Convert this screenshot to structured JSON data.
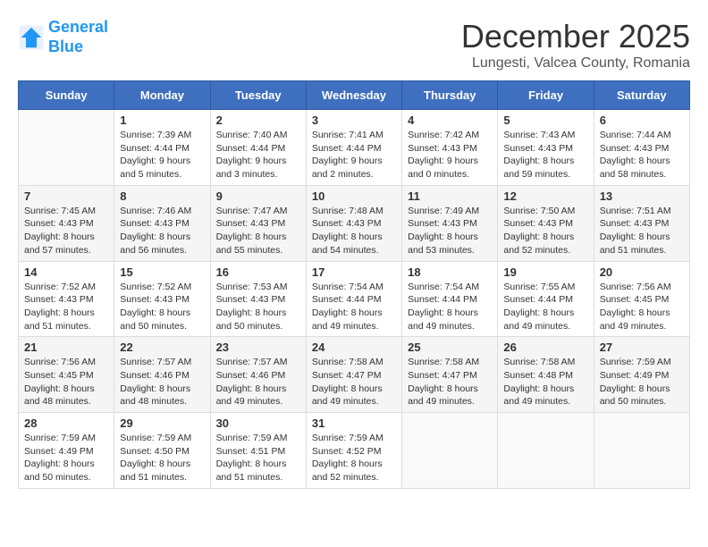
{
  "logo": {
    "line1": "General",
    "line2": "Blue"
  },
  "title": "December 2025",
  "subtitle": "Lungesti, Valcea County, Romania",
  "days_header": [
    "Sunday",
    "Monday",
    "Tuesday",
    "Wednesday",
    "Thursday",
    "Friday",
    "Saturday"
  ],
  "weeks": [
    [
      {
        "day": "",
        "sunrise": "",
        "sunset": "",
        "daylight": ""
      },
      {
        "day": "1",
        "sunrise": "Sunrise: 7:39 AM",
        "sunset": "Sunset: 4:44 PM",
        "daylight": "Daylight: 9 hours and 5 minutes."
      },
      {
        "day": "2",
        "sunrise": "Sunrise: 7:40 AM",
        "sunset": "Sunset: 4:44 PM",
        "daylight": "Daylight: 9 hours and 3 minutes."
      },
      {
        "day": "3",
        "sunrise": "Sunrise: 7:41 AM",
        "sunset": "Sunset: 4:44 PM",
        "daylight": "Daylight: 9 hours and 2 minutes."
      },
      {
        "day": "4",
        "sunrise": "Sunrise: 7:42 AM",
        "sunset": "Sunset: 4:43 PM",
        "daylight": "Daylight: 9 hours and 0 minutes."
      },
      {
        "day": "5",
        "sunrise": "Sunrise: 7:43 AM",
        "sunset": "Sunset: 4:43 PM",
        "daylight": "Daylight: 8 hours and 59 minutes."
      },
      {
        "day": "6",
        "sunrise": "Sunrise: 7:44 AM",
        "sunset": "Sunset: 4:43 PM",
        "daylight": "Daylight: 8 hours and 58 minutes."
      }
    ],
    [
      {
        "day": "7",
        "sunrise": "Sunrise: 7:45 AM",
        "sunset": "Sunset: 4:43 PM",
        "daylight": "Daylight: 8 hours and 57 minutes."
      },
      {
        "day": "8",
        "sunrise": "Sunrise: 7:46 AM",
        "sunset": "Sunset: 4:43 PM",
        "daylight": "Daylight: 8 hours and 56 minutes."
      },
      {
        "day": "9",
        "sunrise": "Sunrise: 7:47 AM",
        "sunset": "Sunset: 4:43 PM",
        "daylight": "Daylight: 8 hours and 55 minutes."
      },
      {
        "day": "10",
        "sunrise": "Sunrise: 7:48 AM",
        "sunset": "Sunset: 4:43 PM",
        "daylight": "Daylight: 8 hours and 54 minutes."
      },
      {
        "day": "11",
        "sunrise": "Sunrise: 7:49 AM",
        "sunset": "Sunset: 4:43 PM",
        "daylight": "Daylight: 8 hours and 53 minutes."
      },
      {
        "day": "12",
        "sunrise": "Sunrise: 7:50 AM",
        "sunset": "Sunset: 4:43 PM",
        "daylight": "Daylight: 8 hours and 52 minutes."
      },
      {
        "day": "13",
        "sunrise": "Sunrise: 7:51 AM",
        "sunset": "Sunset: 4:43 PM",
        "daylight": "Daylight: 8 hours and 51 minutes."
      }
    ],
    [
      {
        "day": "14",
        "sunrise": "Sunrise: 7:52 AM",
        "sunset": "Sunset: 4:43 PM",
        "daylight": "Daylight: 8 hours and 51 minutes."
      },
      {
        "day": "15",
        "sunrise": "Sunrise: 7:52 AM",
        "sunset": "Sunset: 4:43 PM",
        "daylight": "Daylight: 8 hours and 50 minutes."
      },
      {
        "day": "16",
        "sunrise": "Sunrise: 7:53 AM",
        "sunset": "Sunset: 4:43 PM",
        "daylight": "Daylight: 8 hours and 50 minutes."
      },
      {
        "day": "17",
        "sunrise": "Sunrise: 7:54 AM",
        "sunset": "Sunset: 4:44 PM",
        "daylight": "Daylight: 8 hours and 49 minutes."
      },
      {
        "day": "18",
        "sunrise": "Sunrise: 7:54 AM",
        "sunset": "Sunset: 4:44 PM",
        "daylight": "Daylight: 8 hours and 49 minutes."
      },
      {
        "day": "19",
        "sunrise": "Sunrise: 7:55 AM",
        "sunset": "Sunset: 4:44 PM",
        "daylight": "Daylight: 8 hours and 49 minutes."
      },
      {
        "day": "20",
        "sunrise": "Sunrise: 7:56 AM",
        "sunset": "Sunset: 4:45 PM",
        "daylight": "Daylight: 8 hours and 49 minutes."
      }
    ],
    [
      {
        "day": "21",
        "sunrise": "Sunrise: 7:56 AM",
        "sunset": "Sunset: 4:45 PM",
        "daylight": "Daylight: 8 hours and 48 minutes."
      },
      {
        "day": "22",
        "sunrise": "Sunrise: 7:57 AM",
        "sunset": "Sunset: 4:46 PM",
        "daylight": "Daylight: 8 hours and 48 minutes."
      },
      {
        "day": "23",
        "sunrise": "Sunrise: 7:57 AM",
        "sunset": "Sunset: 4:46 PM",
        "daylight": "Daylight: 8 hours and 49 minutes."
      },
      {
        "day": "24",
        "sunrise": "Sunrise: 7:58 AM",
        "sunset": "Sunset: 4:47 PM",
        "daylight": "Daylight: 8 hours and 49 minutes."
      },
      {
        "day": "25",
        "sunrise": "Sunrise: 7:58 AM",
        "sunset": "Sunset: 4:47 PM",
        "daylight": "Daylight: 8 hours and 49 minutes."
      },
      {
        "day": "26",
        "sunrise": "Sunrise: 7:58 AM",
        "sunset": "Sunset: 4:48 PM",
        "daylight": "Daylight: 8 hours and 49 minutes."
      },
      {
        "day": "27",
        "sunrise": "Sunrise: 7:59 AM",
        "sunset": "Sunset: 4:49 PM",
        "daylight": "Daylight: 8 hours and 50 minutes."
      }
    ],
    [
      {
        "day": "28",
        "sunrise": "Sunrise: 7:59 AM",
        "sunset": "Sunset: 4:49 PM",
        "daylight": "Daylight: 8 hours and 50 minutes."
      },
      {
        "day": "29",
        "sunrise": "Sunrise: 7:59 AM",
        "sunset": "Sunset: 4:50 PM",
        "daylight": "Daylight: 8 hours and 51 minutes."
      },
      {
        "day": "30",
        "sunrise": "Sunrise: 7:59 AM",
        "sunset": "Sunset: 4:51 PM",
        "daylight": "Daylight: 8 hours and 51 minutes."
      },
      {
        "day": "31",
        "sunrise": "Sunrise: 7:59 AM",
        "sunset": "Sunset: 4:52 PM",
        "daylight": "Daylight: 8 hours and 52 minutes."
      },
      {
        "day": "",
        "sunrise": "",
        "sunset": "",
        "daylight": ""
      },
      {
        "day": "",
        "sunrise": "",
        "sunset": "",
        "daylight": ""
      },
      {
        "day": "",
        "sunrise": "",
        "sunset": "",
        "daylight": ""
      }
    ]
  ]
}
